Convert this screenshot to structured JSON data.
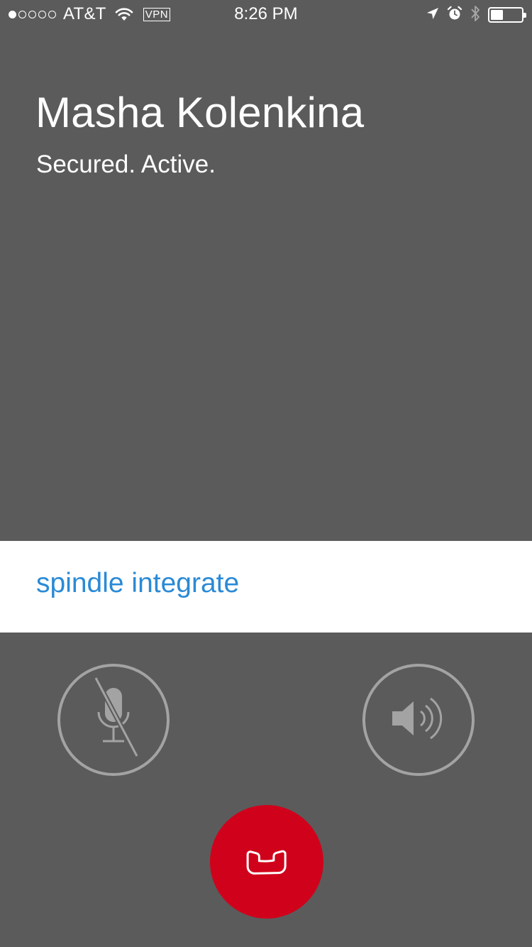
{
  "status_bar": {
    "carrier": "AT&T",
    "vpn": "VPN",
    "time": "8:26 PM",
    "signal_bars_filled": 1,
    "signal_bars_total": 5,
    "battery_level": 0.4,
    "icons": [
      "wifi-icon",
      "location-arrow-icon",
      "alarm-clock-icon",
      "bluetooth-icon",
      "battery-icon"
    ]
  },
  "call": {
    "caller_name": "Masha Kolenkina",
    "status": "Secured. Active."
  },
  "app_band": {
    "link_text": "spindle integrate",
    "link_color": "#2a8ad6"
  },
  "controls": {
    "mute_icon": "microphone-muted-icon",
    "speaker_icon": "speaker-icon",
    "end_call_icon": "phone-hangup-icon",
    "end_call_color": "#d0021b"
  },
  "colors": {
    "background": "#5b5b5b",
    "button_ring": "#a3a3a3"
  }
}
